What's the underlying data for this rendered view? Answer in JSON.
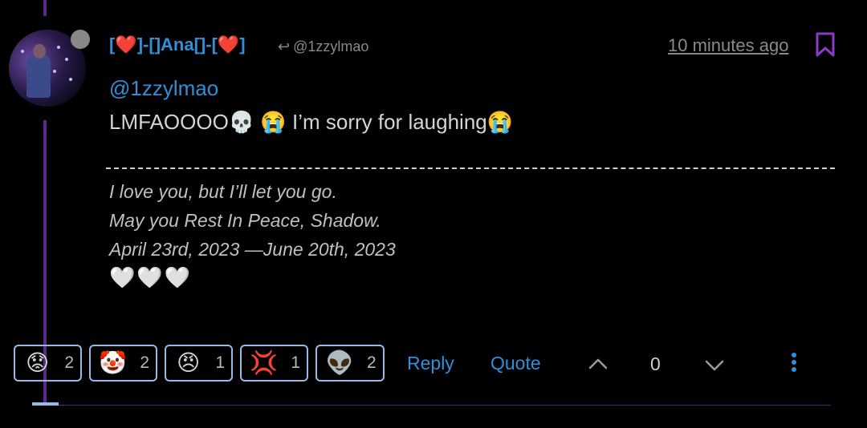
{
  "post": {
    "username": "[❤️]-[]Ana[]-[❤️]",
    "reply_to": "@1zzylmao",
    "timestamp": "10 minutes ago",
    "mention": "@1zzylmao",
    "message": "LMFAOOOO💀 😭 I’m sorry for laughing😭"
  },
  "signature": {
    "line1": "I love you, but I’ll let you go.",
    "line2": "May you Rest In Peace, Shadow.",
    "line3": "April 23rd, 2023 —June 20th, 2023",
    "hearts": "🤍🤍🤍"
  },
  "reactions": [
    {
      "emoji": "😟",
      "icon": "worried-face-icon",
      "count": "2"
    },
    {
      "emoji": "🤡",
      "icon": "clown-face-icon",
      "count": "2"
    },
    {
      "emoji": "😠",
      "icon": "angry-face-icon",
      "count": "1"
    },
    {
      "emoji": "💢",
      "icon": "anger-symbol-icon",
      "count": "1"
    },
    {
      "emoji": "👽",
      "icon": "alien-icon",
      "count": "2"
    }
  ],
  "actions": {
    "reply_label": "Reply",
    "quote_label": "Quote",
    "vote_count": "0"
  },
  "colors": {
    "link_blue": "#2f8fd8",
    "accent_purple": "#8a3cc8",
    "reaction_border": "#9ab8e8",
    "background": "#000000"
  }
}
